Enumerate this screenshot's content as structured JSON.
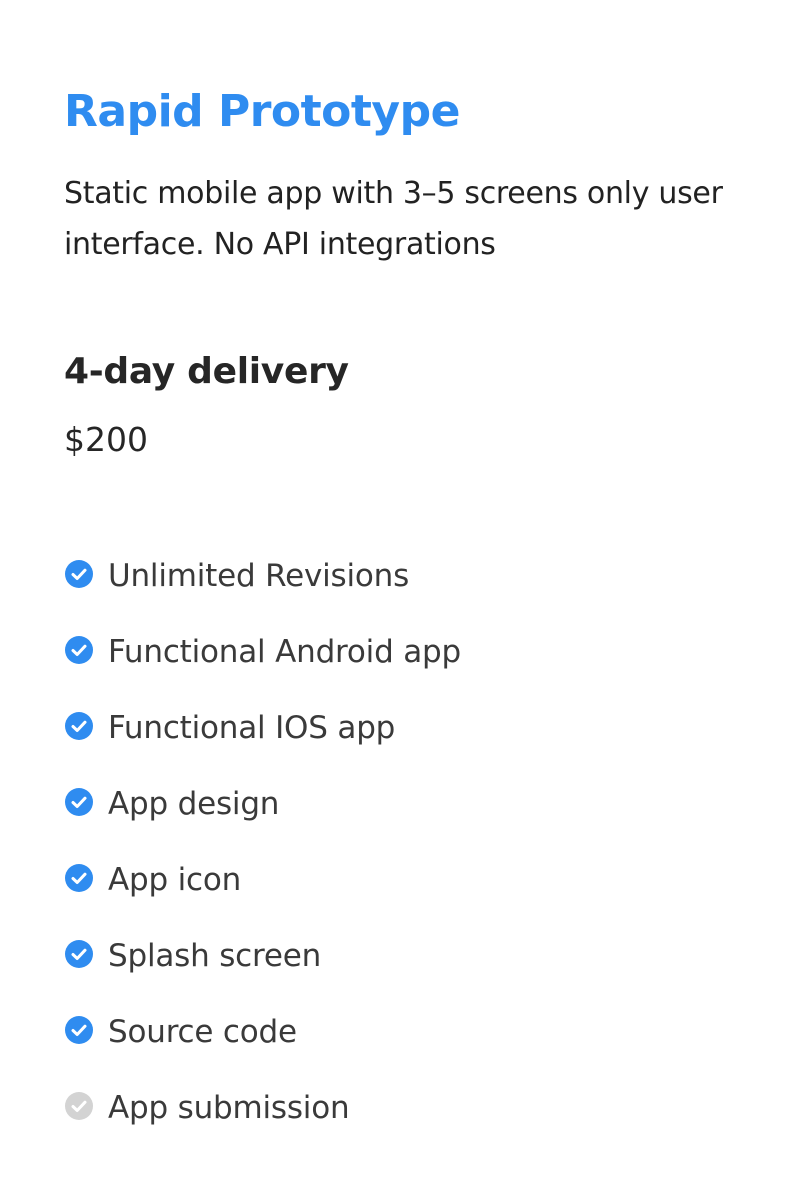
{
  "plan": {
    "title": "Rapid Prototype",
    "description": "Static mobile app with 3–5 screens only user interface. No API integrations",
    "delivery": "4-day delivery",
    "price": "$200",
    "accent_color": "#2f8cf0"
  },
  "features": [
    {
      "label": "Unlimited Revisions",
      "included": true,
      "icon": "check-circle-icon"
    },
    {
      "label": "Functional Android app",
      "included": true,
      "icon": "check-circle-icon"
    },
    {
      "label": "Functional IOS app",
      "included": true,
      "icon": "check-circle-icon"
    },
    {
      "label": "App design",
      "included": true,
      "icon": "check-circle-icon"
    },
    {
      "label": "App icon",
      "included": true,
      "icon": "check-circle-icon"
    },
    {
      "label": "Splash screen",
      "included": true,
      "icon": "check-circle-icon"
    },
    {
      "label": "Source code",
      "included": true,
      "icon": "check-circle-icon"
    },
    {
      "label": "App submission",
      "included": false,
      "icon": "check-circle-icon"
    }
  ],
  "colors": {
    "included": "#2f8cf0",
    "excluded": "#d3d3d3"
  }
}
